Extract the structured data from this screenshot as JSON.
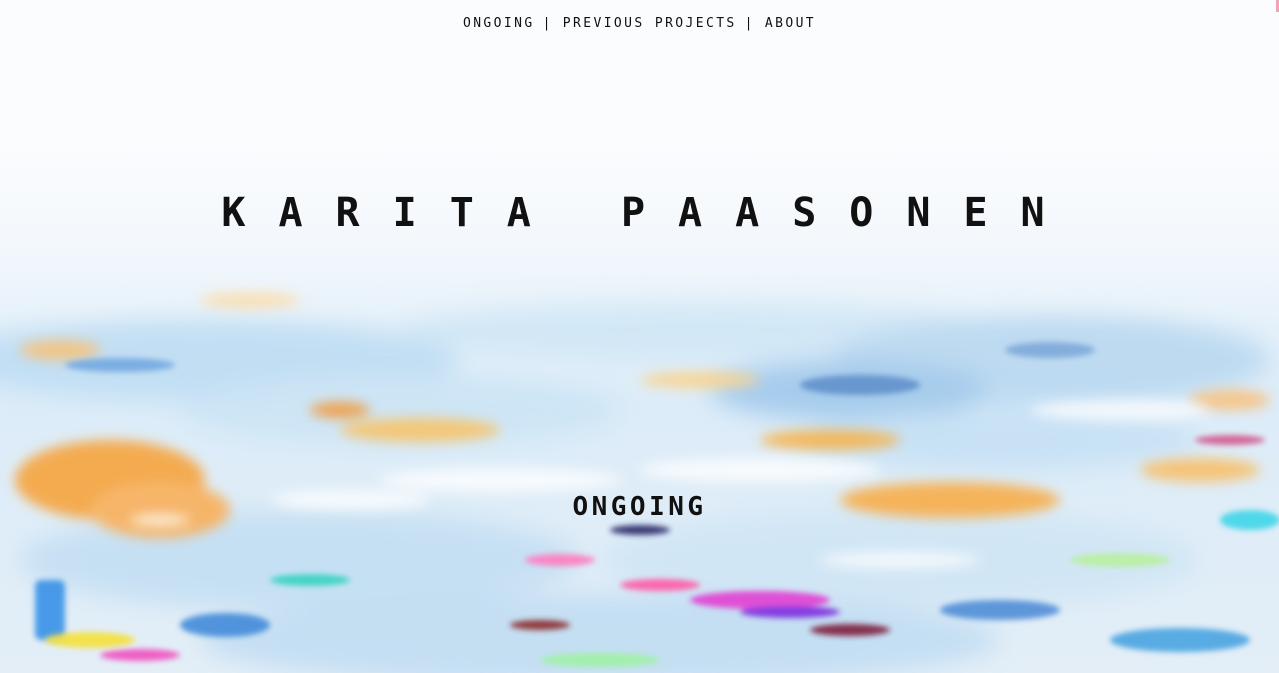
{
  "nav": {
    "items": [
      {
        "label": "ONGOING"
      },
      {
        "label": "PREVIOUS PROJECTS"
      },
      {
        "label": "ABOUT"
      }
    ],
    "separator": "|"
  },
  "header": {
    "title": "KARITA PAASONEN"
  },
  "main": {
    "section_heading": "ONGOING"
  },
  "colors": {
    "background": "#fbfcfe",
    "text": "#111111",
    "art_blue": "#7fb8e6",
    "art_orange": "#f6a34a",
    "art_magenta": "#e03ccf",
    "art_cyan": "#3fd6e8"
  }
}
